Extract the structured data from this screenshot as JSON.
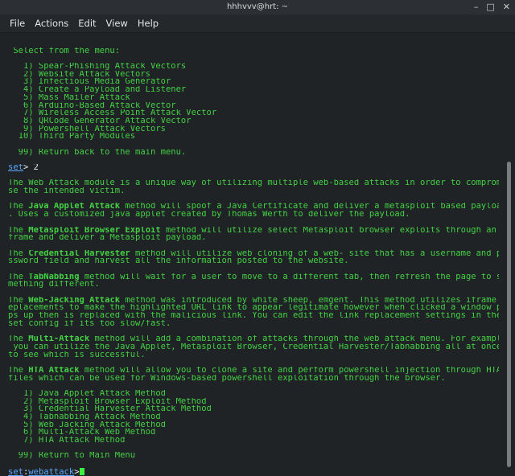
{
  "title": "hhhvvv@hrt: ~",
  "menu": [
    "File",
    "Actions",
    "Edit",
    "View",
    "Help"
  ],
  "terminal": {
    "select_header": " Select from the menu:",
    "main_menu": [
      "   1) Spear-Phishing Attack Vectors",
      "   2) Website Attack Vectors",
      "   3) Infectious Media Generator",
      "   4) Create a Payload and Listener",
      "   5) Mass Mailer Attack",
      "   6) Arduino-Based Attack Vector",
      "   7) Wireless Access Point Attack Vector",
      "   8) QRCode Generator Attack Vector",
      "   9) Powershell Attack Vectors",
      "  10) Third Party Modules"
    ],
    "return_main": "  99) Return back to the main menu.",
    "prompt1": {
      "prefix": "set",
      "suffix": "> 2"
    },
    "intro": [
      "The Web Attack module is a unique way of utilizing multiple web-based attacks in order to comprom",
      "se the intended victim."
    ],
    "descriptions": [
      {
        "lines": [
          {
            "pre": "The ",
            "bold": "Java Applet Attack",
            "post": " method will spoof a Java Certificate and deliver a metasploit based payload"
          },
          {
            "pre": ". Uses a customized java applet created by Thomas Werth to deliver the payload.",
            "bold": "",
            "post": ""
          }
        ]
      },
      {
        "lines": [
          {
            "pre": "The ",
            "bold": "Metasploit Browser Exploit",
            "post": " method will utilize select Metasploit browser exploits through an i"
          },
          {
            "pre": "frame and deliver a Metasploit payload.",
            "bold": "",
            "post": ""
          }
        ]
      },
      {
        "lines": [
          {
            "pre": "The ",
            "bold": "Credential Harvester",
            "post": " method will utilize web cloning of a web- site that has a username and pa"
          },
          {
            "pre": "ssword field and harvest all the information posted to the website.",
            "bold": "",
            "post": ""
          }
        ]
      },
      {
        "lines": [
          {
            "pre": "The ",
            "bold": "TabNabbing",
            "post": " method will wait for a user to move to a different tab, then refresh the page to so"
          },
          {
            "pre": "mething different.",
            "bold": "",
            "post": ""
          }
        ]
      },
      {
        "lines": [
          {
            "pre": "The ",
            "bold": "Web-Jacking Attack",
            "post": " method was introduced by white sheep, emgent. This method utilizes iframe r"
          },
          {
            "pre": "eplacements to make the highlighted URL link to appear legitimate however when clicked a window po",
            "bold": "",
            "post": ""
          },
          {
            "pre": "ps up then is replaced with the malicious link. You can edit the link replacement settings in the",
            "bold": "",
            "post": ""
          },
          {
            "pre": "set_config if its too slow/fast.",
            "bold": "",
            "post": ""
          }
        ]
      },
      {
        "lines": [
          {
            "pre": "The ",
            "bold": "Multi-Attack",
            "post": " method will add a combination of attacks through the web attack menu. For example"
          },
          {
            "pre": " you can utilize the Java Applet, Metasploit Browser, Credential Harvester/Tabnabbing all at once",
            "bold": "",
            "post": ""
          },
          {
            "pre": "to see which is successful.",
            "bold": "",
            "post": ""
          }
        ]
      },
      {
        "lines": [
          {
            "pre": "The ",
            "bold": "HTA Attack",
            "post": " method will allow you to clone a site and perform powershell injection through HTA"
          },
          {
            "pre": "files which can be used for Windows-based powershell exploitation through the browser.",
            "bold": "",
            "post": ""
          }
        ]
      }
    ],
    "web_menu": [
      "   1) Java Applet Attack Method",
      "   2) Metasploit Browser Exploit Method",
      "   3) Credential Harvester Attack Method",
      "   4) Tabnabbing Attack Method",
      "   5) Web Jacking Attack Method",
      "   6) Multi-Attack Web Method",
      "   7) HTA Attack Method"
    ],
    "return_web": "  99) Return to Main Menu",
    "prompt2": {
      "prefix": "set",
      "sep": ":",
      "module": "webattack",
      "suffix": ">"
    }
  }
}
